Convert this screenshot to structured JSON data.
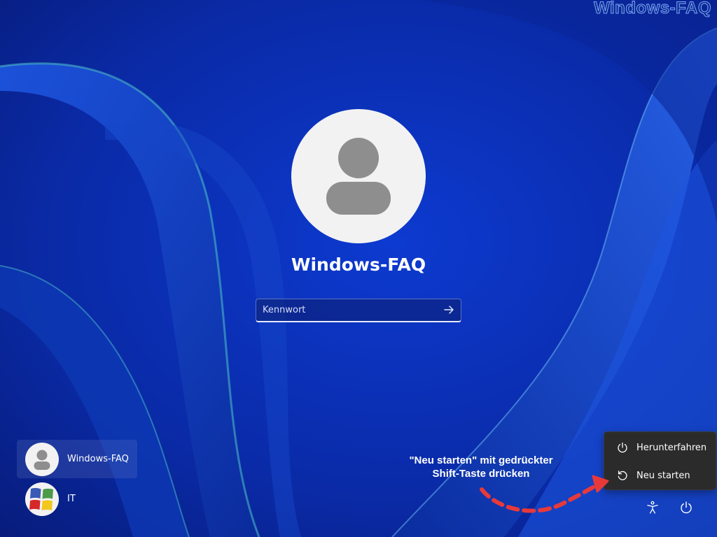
{
  "watermark": "Windows-FAQ",
  "login": {
    "user_name": "Windows-FAQ",
    "password_placeholder": "Kennwort",
    "submit_icon": "arrow-right-icon"
  },
  "user_list": [
    {
      "label": "Windows-FAQ",
      "avatar": "default-user-avatar",
      "selected": true
    },
    {
      "label": "IT",
      "avatar": "colorful-tiles-avatar",
      "selected": false
    }
  ],
  "power_menu": {
    "items": [
      {
        "label": "Herunterfahren",
        "icon": "power-icon"
      },
      {
        "label": "Neu starten",
        "icon": "restart-icon"
      }
    ]
  },
  "bottom_bar": {
    "accessibility_icon": "accessibility-icon",
    "power_icon": "power-icon"
  },
  "annotation": {
    "line1": "\"Neu starten\" mit gedrückter",
    "line2": "Shift-Taste drücken",
    "arrow_color": "#e8393a"
  },
  "colors": {
    "background": "#0a2a9e",
    "menu_background": "#2b2b2b",
    "avatar_background": "#f2f2f2",
    "avatar_silhouette": "#8e8e8e"
  }
}
